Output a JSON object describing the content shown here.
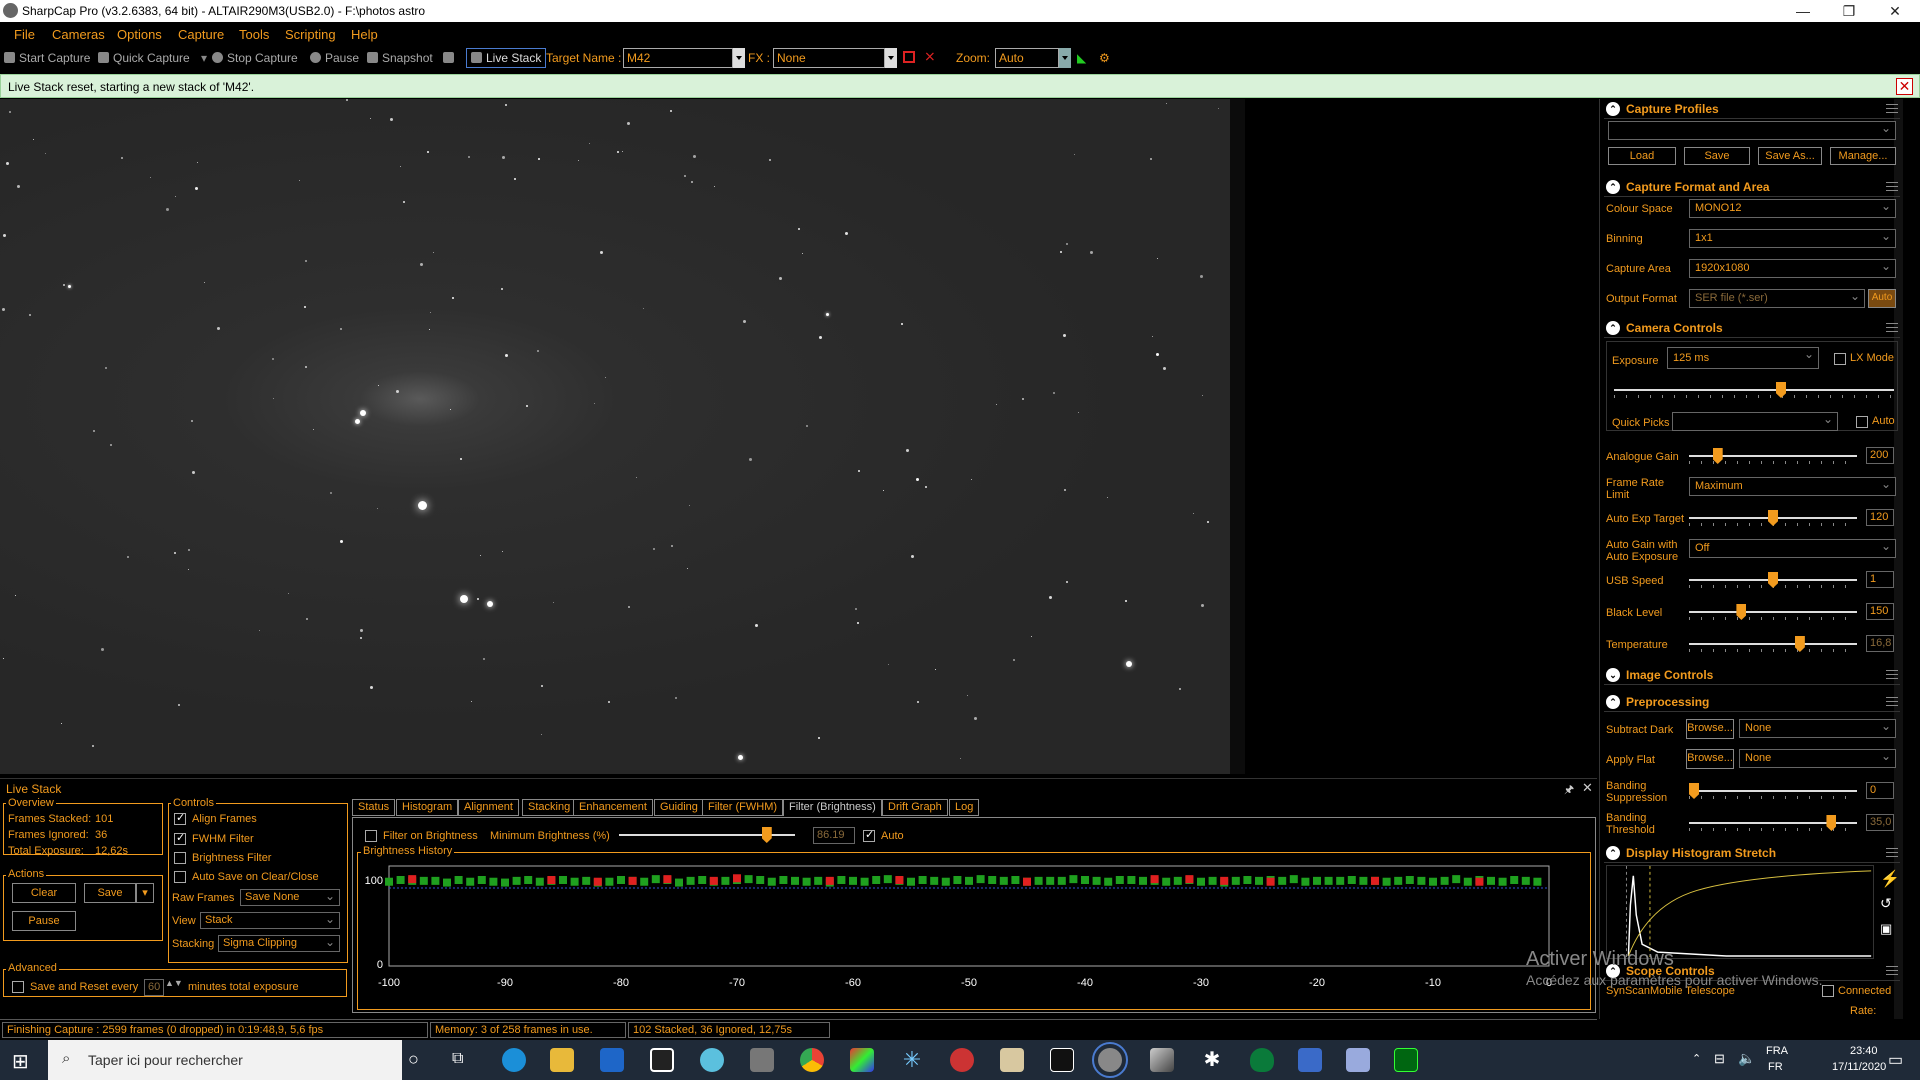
{
  "window": {
    "title": "SharpCap Pro (v3.2.6383, 64 bit) - ALTAIR290M3(USB2.0) - F:\\photos astro",
    "minimize": "—",
    "maximize": "❐",
    "close": "✕"
  },
  "menu": [
    "File",
    "Cameras",
    "Options",
    "Capture",
    "Tools",
    "Scripting",
    "Help"
  ],
  "toolbar": {
    "start_capture": "Start Capture",
    "quick_capture": "Quick Capture",
    "stop_capture": "Stop Capture",
    "pause": "Pause",
    "snapshot": "Snapshot",
    "live_stack": "Live Stack",
    "target_name_label": "Target Name :",
    "target_name_value": "M42",
    "fx_label": "FX :",
    "fx_value": "None",
    "zoom_label": "Zoom:",
    "zoom_value": "Auto"
  },
  "notification": {
    "text": "Live Stack reset, starting a new stack of 'M42'.",
    "close": "✕"
  },
  "right_panel": {
    "capture_profiles": {
      "title": "Capture Profiles",
      "profile": "",
      "load": "Load",
      "save": "Save",
      "save_as": "Save As...",
      "manage": "Manage..."
    },
    "capture_format": {
      "title": "Capture Format and Area",
      "colour_space_label": "Colour Space",
      "colour_space": "MONO12",
      "binning_label": "Binning",
      "binning": "1x1",
      "capture_area_label": "Capture Area",
      "capture_area": "1920x1080",
      "output_format_label": "Output Format",
      "output_format": "SER file (*.ser)",
      "auto": "Auto"
    },
    "camera_controls": {
      "title": "Camera Controls",
      "exposure_label": "Exposure",
      "exposure": "125 ms",
      "lx_mode": "LX Mode",
      "quick_picks_label": "Quick Picks",
      "quick_picks_auto": "Auto",
      "analogue_gain_label": "Analogue Gain",
      "analogue_gain": "200",
      "frame_rate_label": "Frame Rate Limit",
      "frame_rate": "Maximum",
      "auto_exp_target_label": "Auto Exp Target",
      "auto_exp_target": "120",
      "auto_gain_label": "Auto Gain with Auto Exposure",
      "auto_gain": "Off",
      "usb_speed_label": "USB Speed",
      "usb_speed": "1",
      "black_level_label": "Black Level",
      "black_level": "150",
      "temperature_label": "Temperature",
      "temperature": "16,8",
      "levels": {
        "exposure": 0.6,
        "analogue_gain": 0.15,
        "auto_exp_target": 0.5,
        "usb_speed": 0.5,
        "black_level": 0.3,
        "temperature": 0.67
      }
    },
    "image_controls": {
      "title": "Image Controls"
    },
    "preprocessing": {
      "title": "Preprocessing",
      "subtract_dark_label": "Subtract Dark",
      "browse": "Browse...",
      "subtract_dark": "None",
      "apply_flat_label": "Apply Flat",
      "apply_flat": "None",
      "banding_suppression_label": "Banding Suppression",
      "banding_suppression": "0",
      "banding_threshold_label": "Banding Threshold",
      "banding_threshold": "35,0",
      "levels": {
        "banding_suppression": 0.0,
        "banding_threshold": 0.87
      }
    },
    "histogram": {
      "title": "Display Histogram Stretch"
    },
    "scope_controls": {
      "title": "Scope Controls",
      "telescope": "SynScanMobile Telescope",
      "connected": "Connected",
      "rate_label": "Rate:"
    }
  },
  "live_stack": {
    "title": "Live Stack",
    "pin": "🖈",
    "close": "✕",
    "overview": {
      "title": "Overview",
      "frames_stacked_label": "Frames Stacked:",
      "frames_stacked": "101",
      "frames_ignored_label": "Frames Ignored:",
      "frames_ignored": "36",
      "total_exposure_label": "Total Exposure:",
      "total_exposure": "12,62s"
    },
    "actions": {
      "title": "Actions",
      "clear": "Clear",
      "save": "Save",
      "pause": "Pause"
    },
    "advanced": {
      "title": "Advanced",
      "save_reset_label": "Save and Reset every",
      "save_reset_value": "60",
      "save_reset_suffix": "minutes total exposure"
    },
    "controls": {
      "title": "Controls",
      "align_frames": "Align Frames",
      "fwhm_filter": "FWHM Filter",
      "brightness_filter": "Brightness Filter",
      "auto_save": "Auto Save on Clear/Close",
      "raw_frames_label": "Raw Frames",
      "raw_frames": "Save None",
      "view_label": "View",
      "view": "Stack",
      "stacking_label": "Stacking",
      "stacking": "Sigma Clipping"
    },
    "tabs": [
      "Status",
      "Histogram",
      "Alignment",
      "Stacking",
      "Enhancement",
      "Guiding",
      "Filter (FWHM)",
      "Filter (Brightness)",
      "Drift Graph",
      "Log"
    ],
    "active_tab": "Filter (Brightness)",
    "filter": {
      "filter_on_brightness": "Filter on Brightness",
      "min_brightness_label": "Minimum Brightness (%)",
      "min_brightness": "86.19",
      "min_brightness_level": 0.86,
      "auto": "Auto"
    }
  },
  "chart_data": {
    "type": "scatter",
    "title": "Brightness History",
    "xlim": [
      -100,
      0
    ],
    "ylim": [
      0,
      100
    ],
    "x_ticks": [
      "-100",
      "-90",
      "-80",
      "-70",
      "-60",
      "-50",
      "-40",
      "-30",
      "-20",
      "-10",
      "0"
    ],
    "y_ticks": [
      "100",
      "0"
    ],
    "series": [
      {
        "color": "#1fa01f",
        "values": [
          98,
          100,
          99,
          99,
          99,
          97,
          100,
          98,
          100,
          98,
          97,
          99,
          100,
          98,
          99,
          100,
          98,
          99,
          97,
          98,
          100,
          99,
          98,
          101,
          100,
          97,
          99,
          100,
          98,
          99,
          100,
          101,
          100,
          98,
          100,
          99,
          98,
          99,
          97,
          100,
          99,
          98,
          100,
          101,
          99,
          98,
          100,
          99,
          98,
          100,
          99,
          101,
          100,
          99,
          100,
          98,
          99,
          99,
          99,
          101,
          100,
          99,
          98,
          100,
          100,
          99,
          99,
          98,
          99,
          100,
          98,
          99,
          97,
          99,
          100,
          99,
          100,
          99,
          101,
          98,
          99,
          99,
          99,
          100,
          99,
          99,
          98,
          99,
          100,
          99,
          98,
          99,
          101,
          98,
          100,
          99,
          98,
          100,
          99,
          98
        ]
      },
      {
        "color": "#e02020",
        "points": [
          [
            -98,
            101
          ],
          [
            -86,
            100
          ],
          [
            -82,
            98
          ],
          [
            -79,
            99
          ],
          [
            -76,
            101
          ],
          [
            -72,
            99
          ],
          [
            -70,
            102
          ],
          [
            -62,
            99
          ],
          [
            -56,
            100
          ],
          [
            -45,
            98
          ],
          [
            -34,
            101
          ],
          [
            -31,
            101
          ],
          [
            -28,
            99
          ],
          [
            -24,
            98
          ],
          [
            -15,
            99
          ],
          [
            -6,
            98
          ]
        ]
      }
    ]
  },
  "statusbar": {
    "capture": "Finishing Capture : 2599 frames (0 dropped) in 0:19:48,9, 5,6 fps",
    "memory": "Memory: 3 of 258 frames in use.",
    "stack": "102 Stacked, 36 Ignored, 12,75s"
  },
  "watermark": {
    "line1": "Activer Windows",
    "line2": "Accédez aux paramètres pour activer Windows."
  },
  "taskbar": {
    "search": "Taper ici pour rechercher",
    "lang1": "FRA",
    "lang2": "FR",
    "time": "23:40",
    "date": "17/11/2020"
  }
}
